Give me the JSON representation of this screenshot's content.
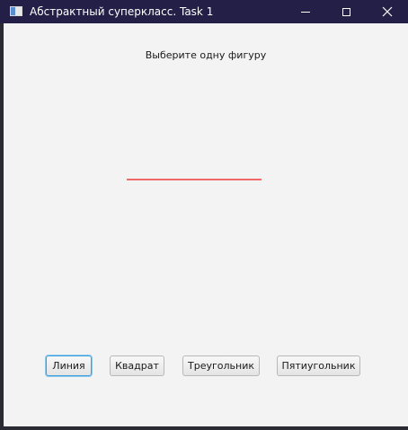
{
  "window": {
    "title": "Абстрактный суперкласс. Task 1"
  },
  "main": {
    "prompt": "Выберите одну фигуру",
    "line_color": "#f06a6a"
  },
  "buttons": {
    "line": "Линия",
    "square": "Квадрат",
    "triangle": "Треугольник",
    "pentagon": "Пятиугольник"
  },
  "colors": {
    "titlebar": "#231f46",
    "client_bg": "#f3f3f3",
    "focus": "#3ca0dc"
  }
}
